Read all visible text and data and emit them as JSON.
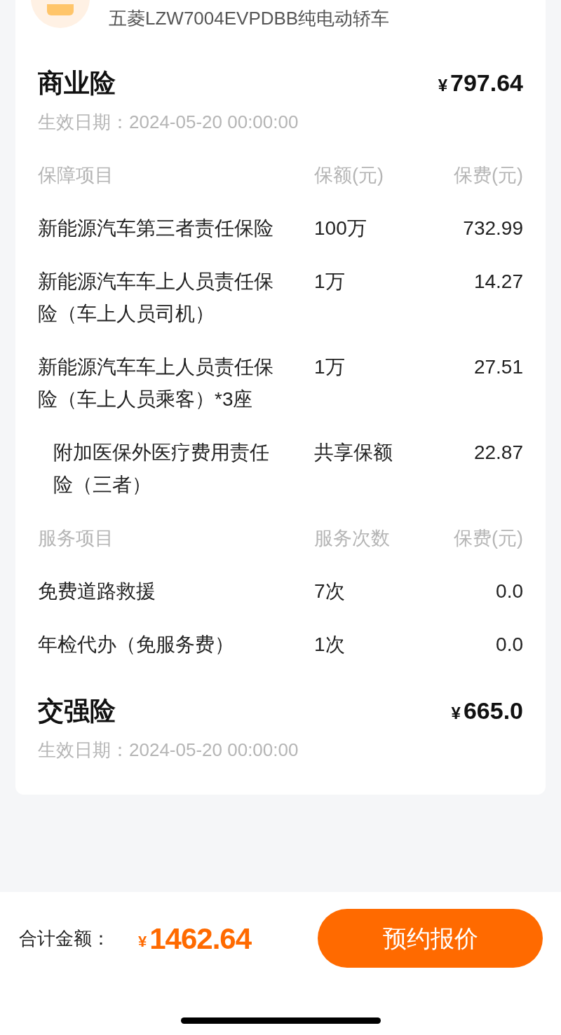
{
  "vehicle": {
    "name": "五菱LZW7004EVPDBB纯电动轿车"
  },
  "policies": [
    {
      "title": "商业险",
      "currency": "¥",
      "price": "797.64",
      "date_label": "生效日期：",
      "date": "2024-05-20 00:00:00",
      "groups": [
        {
          "columns": [
            "保障项目",
            "保额(元)",
            "保费(元)"
          ],
          "rows": [
            {
              "item": "新能源汽车第三者责任保险",
              "amount": "100万",
              "premium": "732.99",
              "sub_item": false
            },
            {
              "item": "新能源汽车车上人员责任保险（车上人员司机）",
              "amount": "1万",
              "premium": "14.27",
              "sub_item": false
            },
            {
              "item": "新能源汽车车上人员责任保险（车上人员乘客）*3座",
              "amount": "1万",
              "premium": "27.51",
              "sub_item": false
            },
            {
              "item": "附加医保外医疗费用责任险（三者）",
              "amount": "共享保额",
              "premium": "22.87",
              "sub_item": true
            }
          ]
        },
        {
          "columns": [
            "服务项目",
            "服务次数",
            "保费(元)"
          ],
          "rows": [
            {
              "item": "免费道路救援",
              "amount": "7次",
              "premium": "0.0",
              "sub_item": false
            },
            {
              "item": "年检代办（免服务费）",
              "amount": "1次",
              "premium": "0.0",
              "sub_item": false
            }
          ]
        }
      ]
    },
    {
      "title": "交强险",
      "currency": "¥",
      "price": "665.0",
      "date_label": "生效日期：",
      "date": "2024-05-20 00:00:00"
    }
  ],
  "total": {
    "label": "合计金额：",
    "currency": "¥",
    "amount": "1462.64"
  },
  "action_button": "预约报价"
}
